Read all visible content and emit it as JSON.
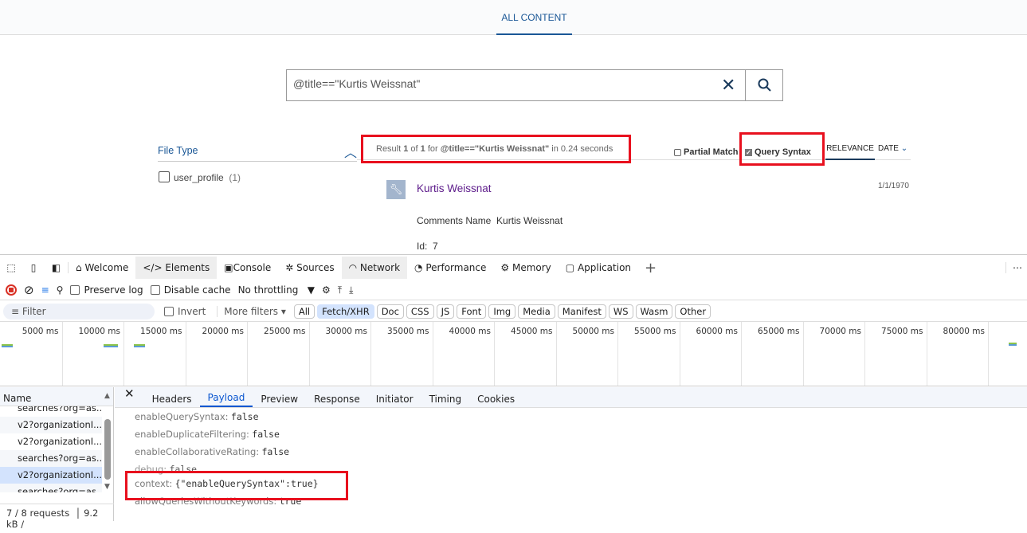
{
  "page": {
    "tab": "ALL CONTENT",
    "search": {
      "value": "@title==\"Kurtis Weissnat\"",
      "clear_icon": "close-icon",
      "search_icon": "magnifier-icon"
    },
    "facet": {
      "title": "File Type",
      "items": [
        {
          "label": "user_profile",
          "count": "(1)"
        }
      ]
    },
    "summary": {
      "prefix": "Result ",
      "first": "1",
      "of": " of ",
      "total": "1",
      "for": " for ",
      "query": "@title==\"Kurtis Weissnat\"",
      "suffix": " in 0.24 seconds"
    },
    "options": {
      "partial_match": "Partial Match",
      "query_syntax": "Query Syntax",
      "query_syntax_checked": true,
      "partial_match_checked": false
    },
    "sort": {
      "relevance": "RELEVANCE",
      "date": "DATE"
    },
    "result": {
      "title": "Kurtis Weissnat",
      "date": "1/1/1970",
      "fields": [
        {
          "label": "Comments Name",
          "value": "Kurtis Weissnat"
        },
        {
          "label": "Id:",
          "value": "7"
        }
      ],
      "icon": "wrench-icon"
    }
  },
  "devtools": {
    "tabs": [
      "Welcome",
      "Elements",
      "Console",
      "Sources",
      "Network",
      "Performance",
      "Memory",
      "Application"
    ],
    "toolbar": {
      "preserve_log": "Preserve log",
      "disable_cache": "Disable cache",
      "throttling": "No throttling"
    },
    "filter": {
      "placeholder": "Filter",
      "invert": "Invert",
      "more_filters": "More filters",
      "types": [
        "All",
        "Fetch/XHR",
        "Doc",
        "CSS",
        "JS",
        "Font",
        "Img",
        "Media",
        "Manifest",
        "WS",
        "Wasm",
        "Other"
      ],
      "active": "Fetch/XHR"
    },
    "timeline": [
      "5000 ms",
      "10000 ms",
      "15000 ms",
      "20000 ms",
      "25000 ms",
      "30000 ms",
      "35000 ms",
      "40000 ms",
      "45000 ms",
      "50000 ms",
      "55000 ms",
      "60000 ms",
      "65000 ms",
      "70000 ms",
      "75000 ms",
      "80000 ms",
      "850"
    ],
    "requests": {
      "header": "Name",
      "items": [
        "searches?org=as...",
        "v2?organizationI...",
        "v2?organizationI...",
        "searches?org=as...",
        "v2?organizationI...",
        "searches?org=as..."
      ],
      "selected": 4,
      "status": "7 / 8 requests",
      "size": "9.2 kB /"
    },
    "detail_tabs": [
      "Headers",
      "Payload",
      "Preview",
      "Response",
      "Initiator",
      "Timing",
      "Cookies"
    ],
    "active_detail_tab": "Payload",
    "payload": [
      {
        "key": "enableQuerySyntax:",
        "value": "false"
      },
      {
        "key": "enableDuplicateFiltering:",
        "value": "false"
      },
      {
        "key": "enableCollaborativeRating:",
        "value": "false"
      },
      {
        "key": "debug:",
        "value": "false"
      },
      {
        "key": "context:",
        "value": "{\"enableQuerySyntax\":true}"
      },
      {
        "key": "allowQueriesWithoutKeywords:",
        "value": "true"
      }
    ]
  }
}
